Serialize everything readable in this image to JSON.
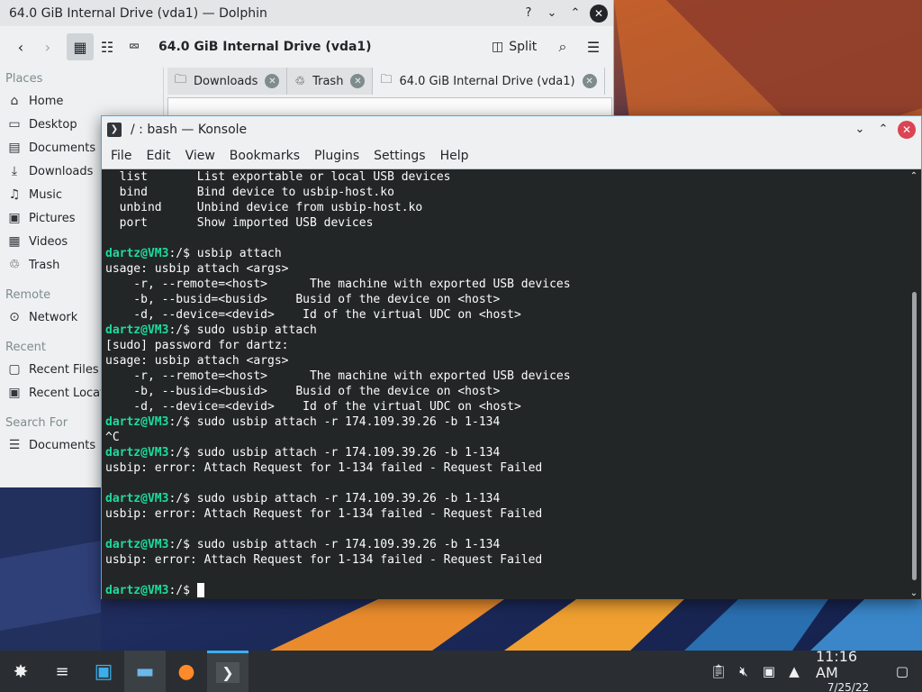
{
  "dolphin": {
    "title": "64.0 GiB Internal Drive (vda1) — Dolphin",
    "window_buttons": {
      "help": "?",
      "minimize": "⌄",
      "maximize": "⌃",
      "close": "✕"
    },
    "location_title": "64.0 GiB Internal Drive (vda1)",
    "split_label": "Split",
    "places": {
      "sections": [
        {
          "title": "Places",
          "items": [
            "Home",
            "Desktop",
            "Documents",
            "Downloads",
            "Music",
            "Pictures",
            "Videos",
            "Trash"
          ]
        },
        {
          "title": "Remote",
          "items": [
            "Network"
          ]
        },
        {
          "title": "Recent",
          "items": [
            "Recent Files",
            "Recent Locati"
          ]
        },
        {
          "title": "Search For",
          "items": [
            "Documents"
          ]
        }
      ]
    },
    "tabs": [
      {
        "label": "Downloads",
        "icon": "folder-icon"
      },
      {
        "label": "Trash",
        "icon": "trash-icon"
      },
      {
        "label": "64.0 GiB Internal Drive (vda1)",
        "icon": "folder-icon",
        "active": true
      }
    ]
  },
  "konsole": {
    "title": "/ : bash — Konsole",
    "menu": [
      "File",
      "Edit",
      "View",
      "Bookmarks",
      "Plugins",
      "Settings",
      "Help"
    ],
    "lines": [
      {
        "text": "  list       List exportable or local USB devices"
      },
      {
        "text": "  bind       Bind device to usbip-host.ko"
      },
      {
        "text": "  unbind     Unbind device from usbip-host.ko"
      },
      {
        "text": "  port       Show imported USB devices"
      },
      {
        "text": ""
      },
      {
        "prompt": "dartz@VM3",
        "text": ":/$ usbip attach"
      },
      {
        "text": "usage: usbip attach <args>"
      },
      {
        "text": "    -r, --remote=<host>      The machine with exported USB devices"
      },
      {
        "text": "    -b, --busid=<busid>    Busid of the device on <host>"
      },
      {
        "text": "    -d, --device=<devid>    Id of the virtual UDC on <host>"
      },
      {
        "prompt": "dartz@VM3",
        "text": ":/$ sudo usbip attach"
      },
      {
        "text": "[sudo] password for dartz:"
      },
      {
        "text": "usage: usbip attach <args>"
      },
      {
        "text": "    -r, --remote=<host>      The machine with exported USB devices"
      },
      {
        "text": "    -b, --busid=<busid>    Busid of the device on <host>"
      },
      {
        "text": "    -d, --device=<devid>    Id of the virtual UDC on <host>"
      },
      {
        "prompt": "dartz@VM3",
        "text": ":/$ sudo usbip attach -r 174.109.39.26 -b 1-134"
      },
      {
        "text": "^C"
      },
      {
        "prompt": "dartz@VM3",
        "text": ":/$ sudo usbip attach -r 174.109.39.26 -b 1-134"
      },
      {
        "text": "usbip: error: Attach Request for 1-134 failed - Request Failed"
      },
      {
        "text": ""
      },
      {
        "prompt": "dartz@VM3",
        "text": ":/$ sudo usbip attach -r 174.109.39.26 -b 1-134"
      },
      {
        "text": "usbip: error: Attach Request for 1-134 failed - Request Failed"
      },
      {
        "text": ""
      },
      {
        "prompt": "dartz@VM3",
        "text": ":/$ sudo usbip attach -r 174.109.39.26 -b 1-134"
      },
      {
        "text": "usbip: error: Attach Request for 1-134 failed - Request Failed"
      },
      {
        "text": ""
      },
      {
        "prompt": "dartz@VM3",
        "text": ":/$ ",
        "cursor": true
      }
    ]
  },
  "taskbar": {
    "time": "11:16 AM",
    "date": "7/25/22"
  },
  "colors": {
    "accent": "#3daee9",
    "prompt_green": "#1cdc9a",
    "terminal_bg": "#232627",
    "close_red": "#da4453"
  }
}
